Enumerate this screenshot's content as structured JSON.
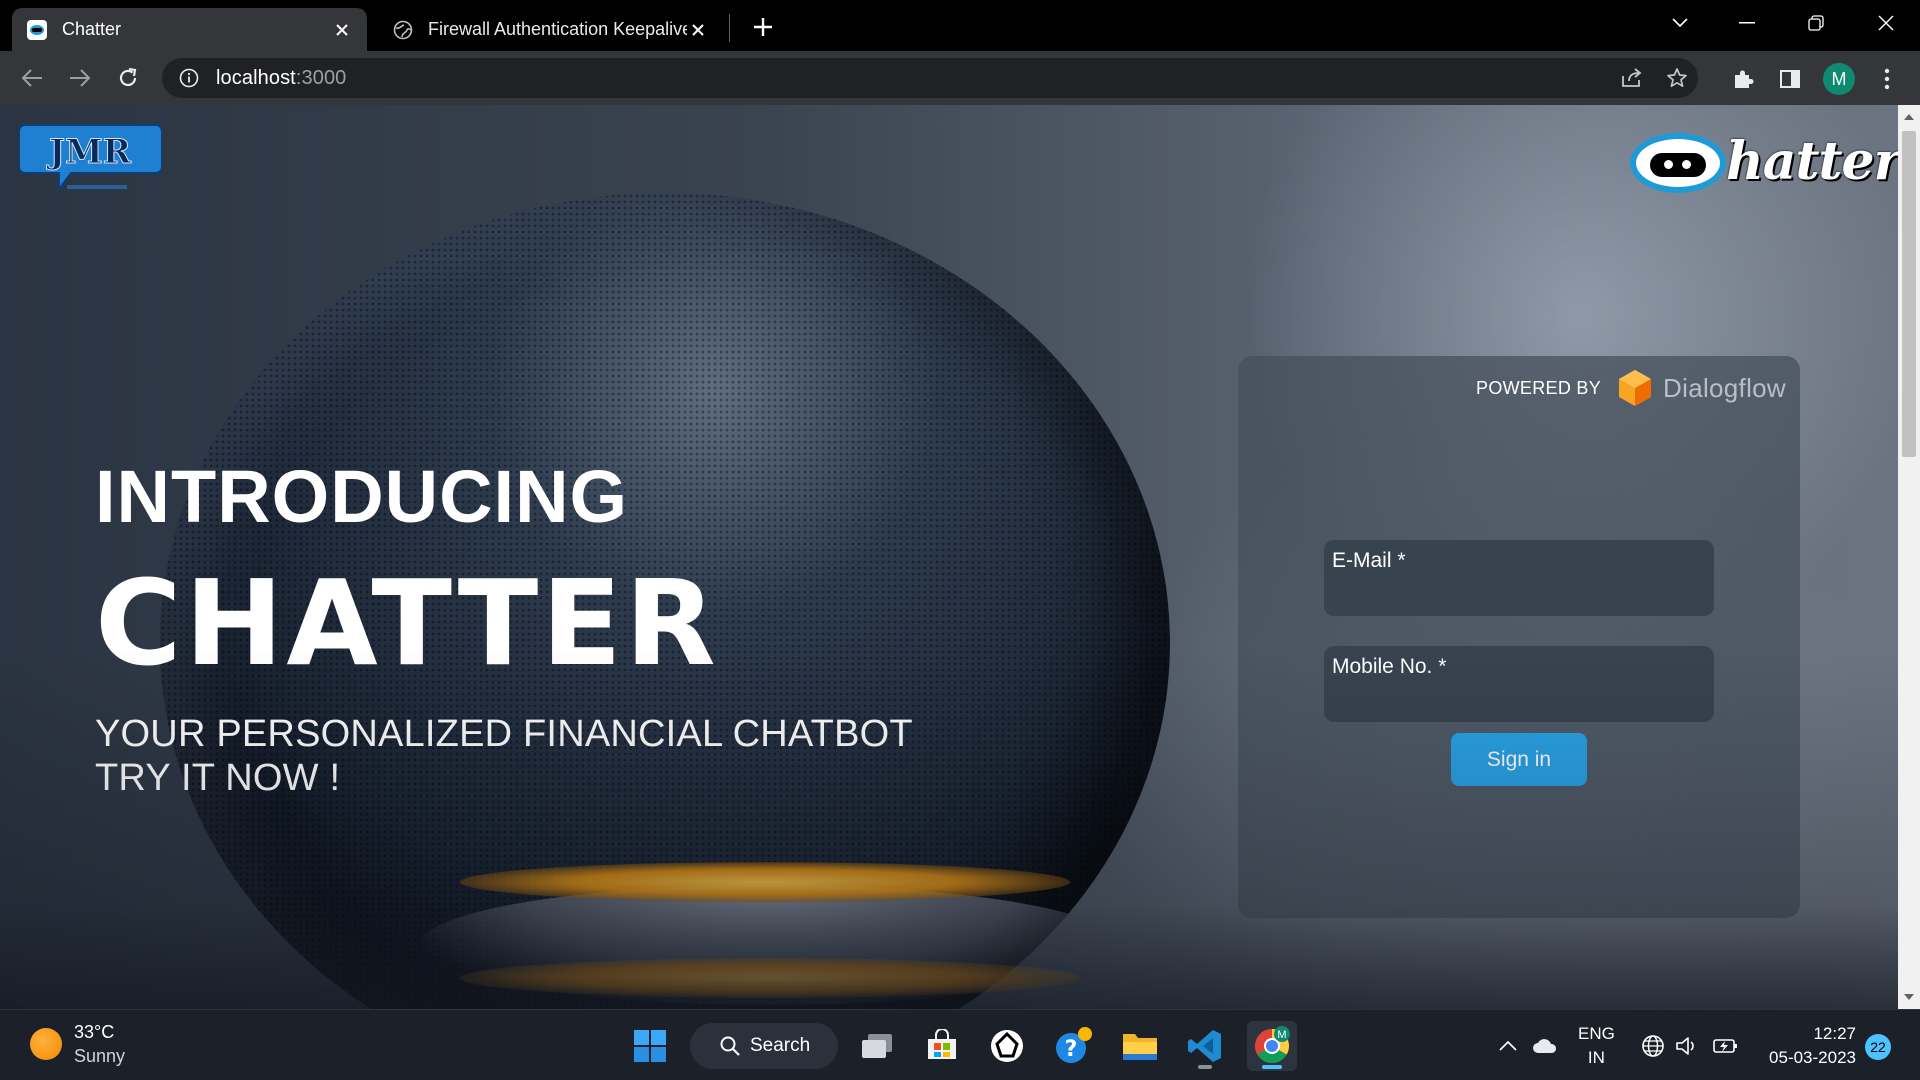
{
  "browser": {
    "tabs": [
      {
        "title": "Chatter",
        "active": true
      },
      {
        "title": "Firewall Authentication Keepalive",
        "active": false
      }
    ],
    "url_host": "localhost",
    "url_port": ":3000",
    "profile_initial": "M"
  },
  "page": {
    "brand_logo": "JMR",
    "app_logo": "hatter",
    "hero": {
      "intro": "INTRODUCING",
      "title": "CHATTER",
      "subtitle_line1": "YOUR PERSONALIZED FINANCIAL CHATBOT",
      "subtitle_line2": "TRY IT NOW !"
    },
    "login": {
      "powered_by": "POWERED BY",
      "provider": "Dialogflow",
      "email_label": "E-Mail *",
      "email_value": "",
      "mobile_label": "Mobile No. *",
      "mobile_value": "",
      "signin_label": "Sign in"
    }
  },
  "taskbar": {
    "weather_temp": "33°C",
    "weather_cond": "Sunny",
    "search_label": "Search",
    "lang_top": "ENG",
    "lang_bottom": "IN",
    "time": "12:27",
    "date": "05-03-2023",
    "notification_count": "22"
  },
  "colors": {
    "accent": "#29a3e6",
    "tab_active": "#35363a",
    "card_bg": "#46505c",
    "field_bg": "#384350",
    "taskbar": "#1c2129"
  }
}
